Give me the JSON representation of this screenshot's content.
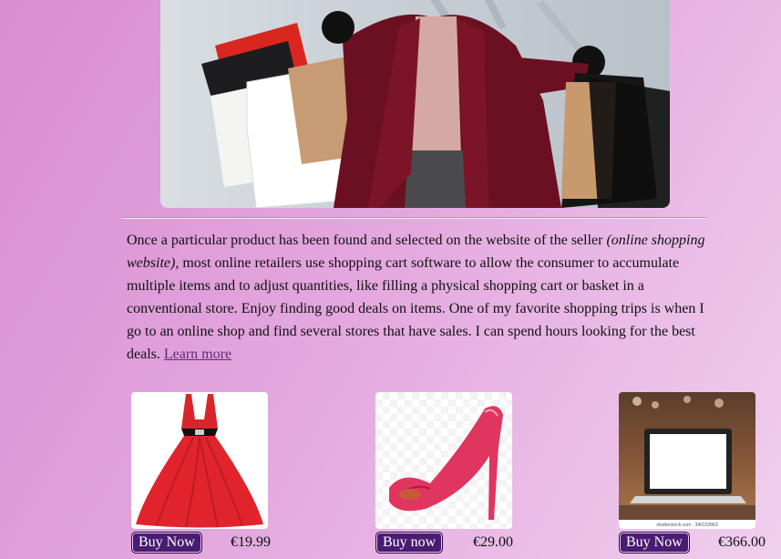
{
  "article": {
    "text_1": "Once a particular product has been found and selected on the website of the seller ",
    "text_italic": "(online shopping website)",
    "text_2": ", most online retailers use shopping cart software to allow the consumer to accumulate multiple items and to adjust quantities, like filling a physical shopping cart or basket in a conventional store. Enjoy finding good deals on items. One of my favorite shopping trips is when I go to an online shop and find several stores that have sales. I can spend hours looking for the best deals. ",
    "link_label": "Learn more"
  },
  "products": [
    {
      "name": "red-dress",
      "button_label": "Buy Now",
      "price": "€19.99"
    },
    {
      "name": "pink-heels",
      "button_label": "Buy now",
      "price": "€29.00"
    },
    {
      "name": "laptop",
      "button_label": "Buy Now",
      "price": "€366.00",
      "image_caption": "shutterstock.com · 340152863"
    }
  ],
  "colors": {
    "button_bg": "#4a1b73",
    "link": "#5d2a78",
    "page_gradient_start": "#d98dd2",
    "page_gradient_end": "#f0cfee"
  }
}
